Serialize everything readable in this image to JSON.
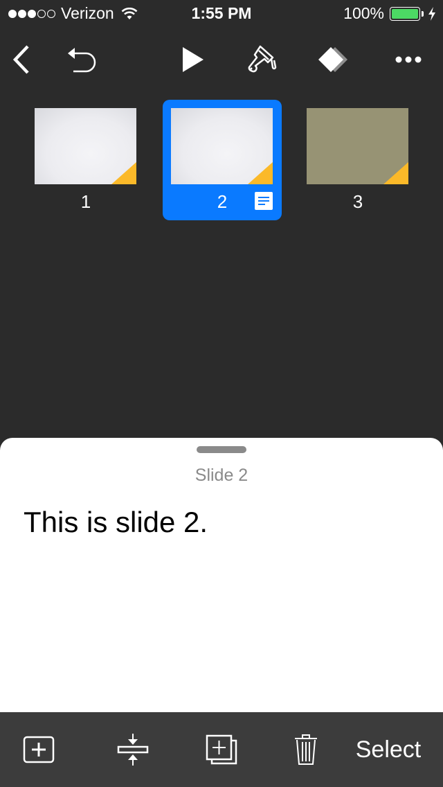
{
  "status_bar": {
    "signal_strength": "3 of 5",
    "carrier": "Verizon",
    "time": "1:55 PM",
    "battery_percent": "100%",
    "battery_level": 1.0,
    "charging": true
  },
  "toolbar": {
    "buttons": [
      {
        "name": "back",
        "icon": "chevron-left-icon"
      },
      {
        "name": "undo",
        "icon": "undo-icon"
      },
      {
        "name": "play",
        "icon": "play-icon"
      },
      {
        "name": "format",
        "icon": "paintbrush-icon"
      },
      {
        "name": "animate",
        "icon": "animate-diamond-icon"
      },
      {
        "name": "more",
        "icon": "ellipsis-icon"
      }
    ]
  },
  "slides": [
    {
      "number": "1",
      "background": "light",
      "selected": false,
      "has_notes": false
    },
    {
      "number": "2",
      "background": "light",
      "selected": true,
      "has_notes": true
    },
    {
      "number": "3",
      "background": "olive",
      "selected": false,
      "has_notes": false
    }
  ],
  "notes_panel": {
    "title": "Slide 2",
    "text": "This is slide 2."
  },
  "bottom_bar": {
    "buttons": [
      {
        "name": "add-slide",
        "icon": "add-slide-icon"
      },
      {
        "name": "skip-slide",
        "icon": "collapse-icon"
      },
      {
        "name": "duplicate",
        "icon": "duplicate-icon"
      },
      {
        "name": "delete",
        "icon": "trash-icon"
      }
    ],
    "select_label": "Select"
  },
  "colors": {
    "background": "#2b2b2b",
    "accent": "#0a7aff",
    "battery": "#4cd964",
    "corner": "#fbb929",
    "bottom_bar": "#3c3c3c"
  }
}
